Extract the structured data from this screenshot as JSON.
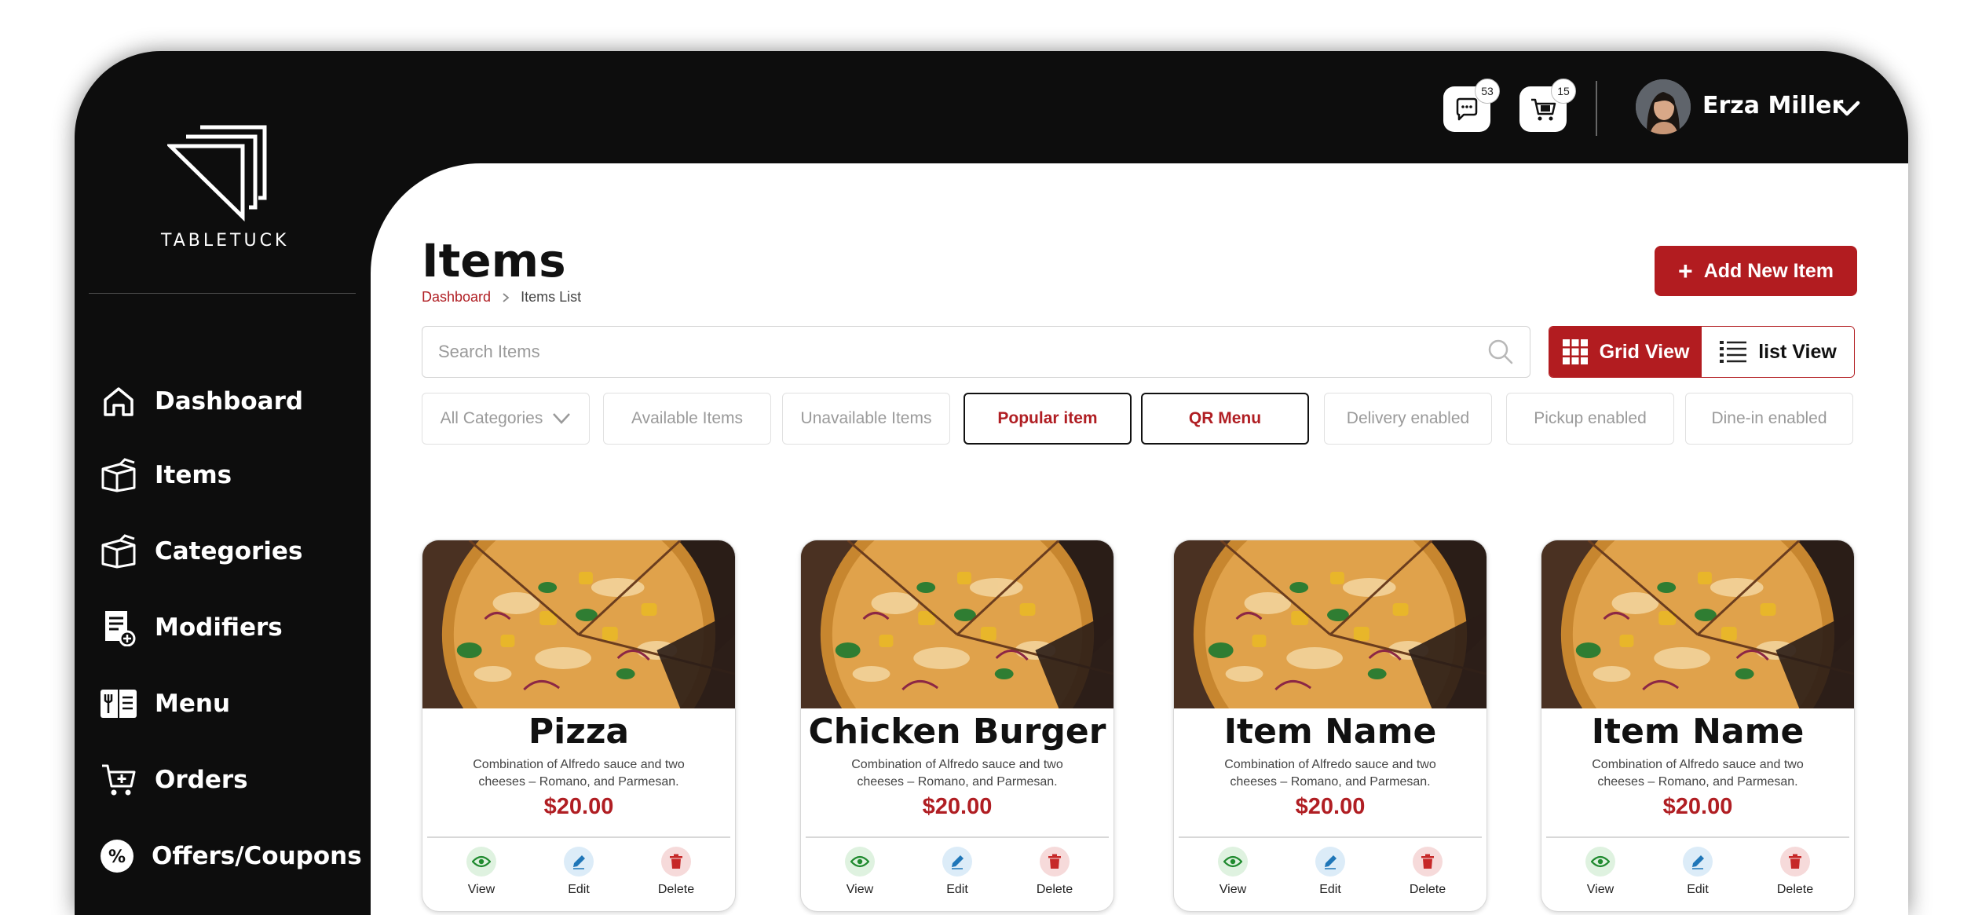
{
  "brand": {
    "name": "TABLETUCK"
  },
  "sidebar": {
    "items": [
      {
        "label": "Dashboard"
      },
      {
        "label": "Items"
      },
      {
        "label": "Categories"
      },
      {
        "label": "Modifiers"
      },
      {
        "label": "Menu"
      },
      {
        "label": "Orders"
      },
      {
        "label": "Offers/Coupons"
      }
    ]
  },
  "topbar": {
    "messages_count": "53",
    "cart_count": "15",
    "user_name": "Erza Miller"
  },
  "page": {
    "title": "Items",
    "breadcrumb": {
      "root": "Dashboard",
      "current": "Items List"
    },
    "add_button": "Add New Item"
  },
  "search": {
    "placeholder": "Search Items"
  },
  "view_toggle": {
    "grid": "Grid View",
    "list": "list View"
  },
  "filters": {
    "category": "All Categories",
    "available": "Available Items",
    "unavailable": "Unavailable Items",
    "popular": "Popular item",
    "qr": "QR Menu",
    "delivery": "Delivery enabled",
    "pickup": "Pickup enabled",
    "dinein": "Dine-in enabled"
  },
  "cards": [
    {
      "name": "Pizza",
      "description": "Combination of Alfredo sauce and two cheeses – Romano, and Parmesan.",
      "price": "$20.00"
    },
    {
      "name": "Chicken Burger",
      "description": "Combination of Alfredo sauce and two cheeses – Romano, and Parmesan.",
      "price": "$20.00"
    },
    {
      "name": "Item Name",
      "description": "Combination of Alfredo sauce and two cheeses – Romano, and Parmesan.",
      "price": "$20.00"
    },
    {
      "name": "Item Name",
      "description": "Combination of Alfredo sauce and two cheeses – Romano, and Parmesan.",
      "price": "$20.00"
    }
  ],
  "card_actions": {
    "view": "View",
    "edit": "Edit",
    "delete": "Delete"
  },
  "colors": {
    "brand_red": "#b21c20",
    "sidebar_bg": "#0d0d0d",
    "price_red": "#b01e23"
  }
}
